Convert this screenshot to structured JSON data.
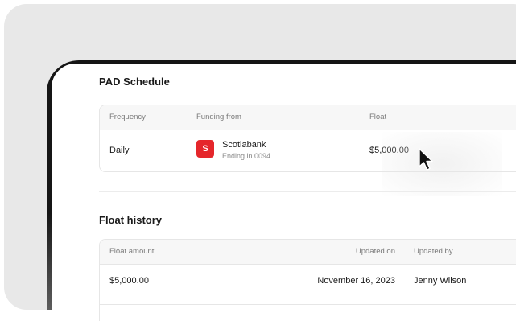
{
  "pad_schedule": {
    "title": "PAD Schedule",
    "headers": {
      "frequency": "Frequency",
      "funding_from": "Funding from",
      "float": "Float"
    },
    "row": {
      "frequency": "Daily",
      "bank_logo_letter": "S",
      "bank_name": "Scotiabank",
      "bank_sub": "Ending in 0094",
      "float": "$5,000.00"
    }
  },
  "float_history": {
    "title": "Float history",
    "headers": {
      "float_amount": "Float amount",
      "updated_on": "Updated on",
      "updated_by": "Updated by"
    },
    "rows": [
      {
        "float_amount": "$5,000.00",
        "updated_on": "November 16, 2023",
        "updated_by": "Jenny Wilson"
      }
    ]
  },
  "colors": {
    "bank_red": "#e5262b",
    "frame": "#151515",
    "backdrop": "#e8e8e8"
  },
  "icons": {
    "cursor": "mouse-pointer-icon"
  }
}
